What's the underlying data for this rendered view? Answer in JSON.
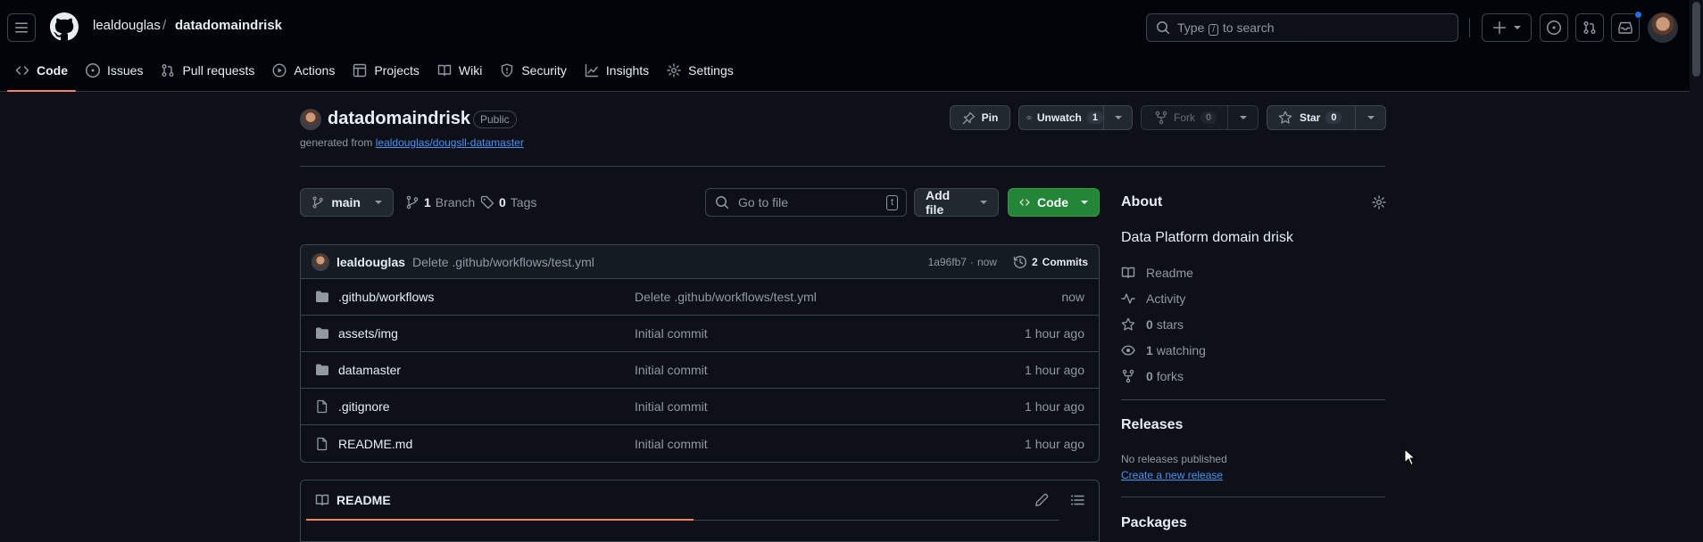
{
  "header": {
    "owner": "lealdouglas",
    "separator": "/",
    "repo": "datadomaindrisk",
    "search_text_before": "Type",
    "search_key": "/",
    "search_text_after": "to search"
  },
  "tabs": [
    {
      "label": "Code"
    },
    {
      "label": "Issues"
    },
    {
      "label": "Pull requests"
    },
    {
      "label": "Actions"
    },
    {
      "label": "Projects"
    },
    {
      "label": "Wiki"
    },
    {
      "label": "Security"
    },
    {
      "label": "Insights"
    },
    {
      "label": "Settings"
    }
  ],
  "repo": {
    "name": "datadomaindrisk",
    "visibility": "Public",
    "generated_prefix": "generated from",
    "template": "lealdouglas/dougsll-datamaster"
  },
  "actions": {
    "pin": "Pin",
    "unwatch": "Unwatch",
    "unwatch_count": "1",
    "fork": "Fork",
    "fork_count": "0",
    "star": "Star",
    "star_count": "0"
  },
  "toolbar": {
    "branch": "main",
    "branch_count": "1",
    "branch_label": "Branch",
    "tag_count": "0",
    "tag_label": "Tags",
    "goto_placeholder": "Go to file",
    "goto_key": "t",
    "add_file": "Add file",
    "code": "Code"
  },
  "commit": {
    "author": "lealdouglas",
    "message": "Delete .github/workflows/test.yml",
    "hash": "1a96fb7",
    "dot": "·",
    "time": "now",
    "commits_count": "2",
    "commits_label": "Commits"
  },
  "files": [
    {
      "name": ".github/workflows",
      "type": "folder",
      "message": "Delete .github/workflows/test.yml",
      "age": "now"
    },
    {
      "name": "assets/img",
      "type": "folder",
      "message": "Initial commit",
      "age": "1 hour ago"
    },
    {
      "name": "datamaster",
      "type": "folder",
      "message": "Initial commit",
      "age": "1 hour ago"
    },
    {
      "name": ".gitignore",
      "type": "file",
      "message": "Initial commit",
      "age": "1 hour ago"
    },
    {
      "name": "README.md",
      "type": "file",
      "message": "Initial commit",
      "age": "1 hour ago"
    }
  ],
  "readme": {
    "title": "README"
  },
  "about": {
    "heading": "About",
    "description": "Data Platform domain drisk",
    "readme": "Readme",
    "activity": "Activity",
    "stars_count": "0",
    "stars_label": "stars",
    "watching_count": "1",
    "watching_label": "watching",
    "forks_count": "0",
    "forks_label": "forks"
  },
  "releases": {
    "heading": "Releases",
    "none": "No releases published",
    "create": "Create a new release"
  },
  "packages": {
    "heading": "Packages"
  },
  "colors": {
    "bg": "#0d1117",
    "header_bg": "#010409",
    "accent_tab": "#f78166",
    "code_button": "#238636",
    "link": "#4493f8",
    "notification_dot": "#1f6feb"
  }
}
